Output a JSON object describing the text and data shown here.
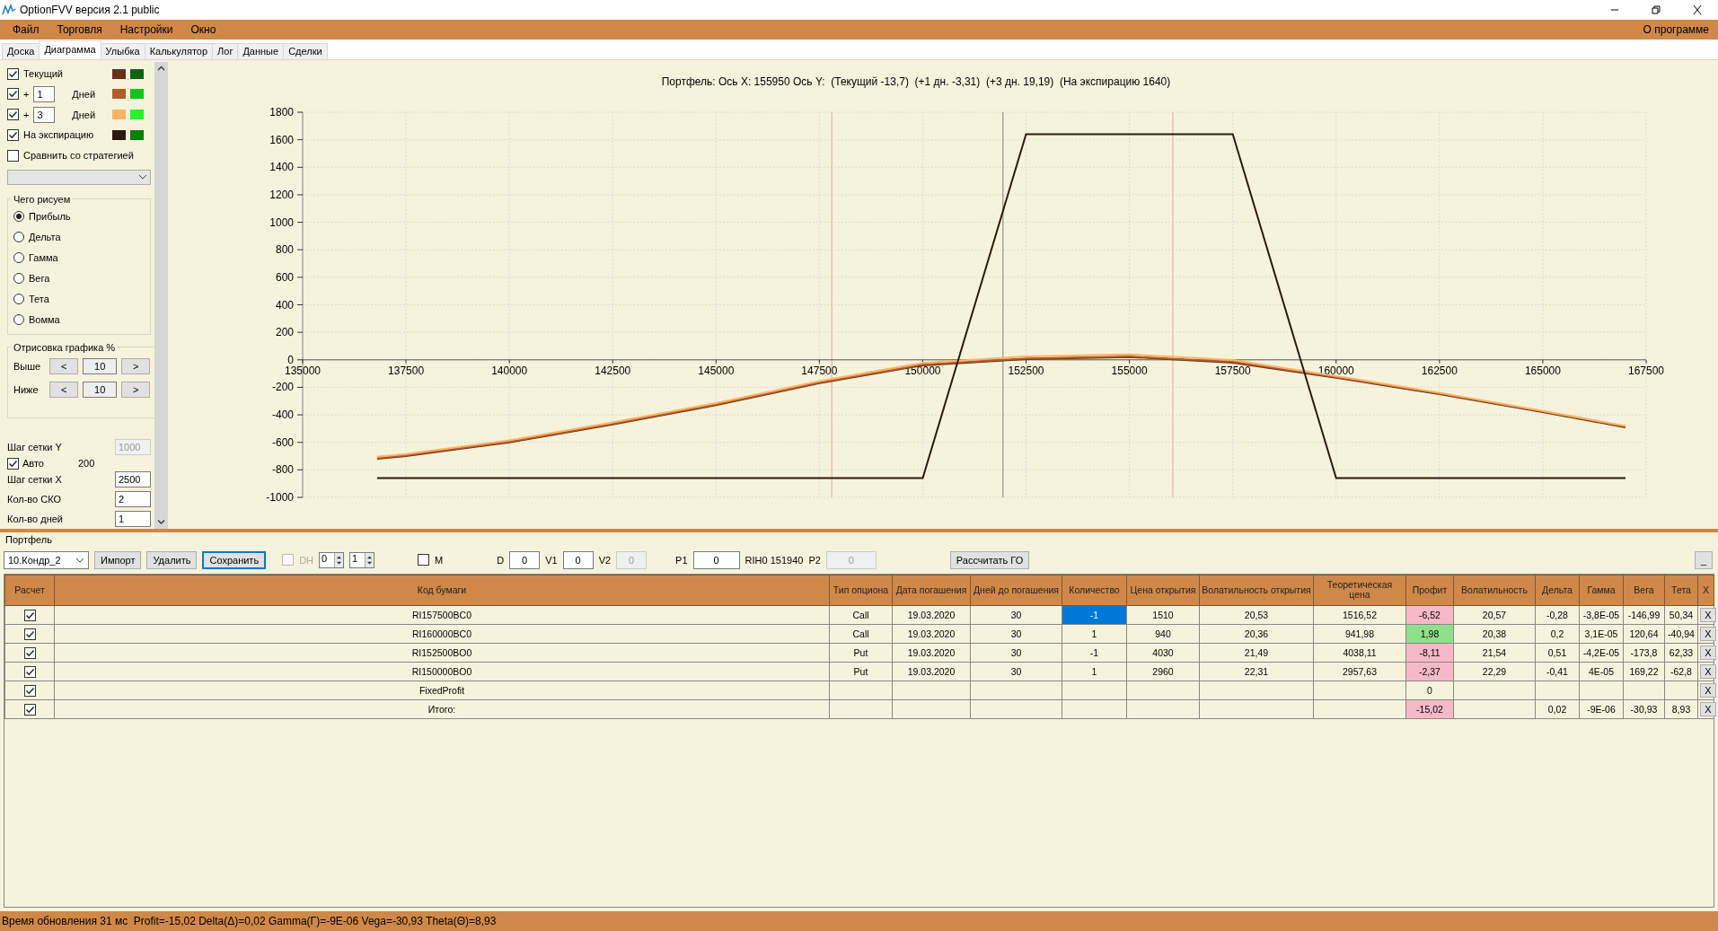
{
  "window": {
    "title": "OptionFVV версия 2.1 public"
  },
  "menu": {
    "items": [
      "Файл",
      "Торговля",
      "Настройки",
      "Окно"
    ],
    "right": "О программе"
  },
  "tabs": [
    {
      "label": "Доска",
      "selected": false
    },
    {
      "label": "Диаграмма",
      "selected": true
    },
    {
      "label": "Улыбка",
      "selected": false
    },
    {
      "label": "Калькулятор",
      "selected": false
    },
    {
      "label": "Лог",
      "selected": false
    },
    {
      "label": "Данные",
      "selected": false
    },
    {
      "label": "Сделки",
      "selected": false
    }
  ],
  "left_panel": {
    "series": [
      {
        "label": "Текущий",
        "checked": true,
        "swatches": [
          {
            "color": "#66301a"
          },
          {
            "color": "#0b6414"
          }
        ]
      },
      {
        "prefix": "+",
        "days": "1",
        "label": "Дней",
        "checked": true,
        "swatches": [
          {
            "color": "#b25c28"
          },
          {
            "color": "#13c41c"
          }
        ]
      },
      {
        "prefix": "+",
        "days": "3",
        "label": "Дней",
        "checked": true,
        "swatches": [
          {
            "color": "#ffb266"
          },
          {
            "color": "#2cf02c"
          }
        ]
      },
      {
        "label": "На экспирацию",
        "checked": true,
        "swatches": [
          {
            "color": "#2e1a0c"
          },
          {
            "color": "#068006"
          }
        ]
      }
    ],
    "compare": {
      "label": "Сравнить со стратегией",
      "checked": false
    },
    "draw_group": {
      "title": "Чего рисуем",
      "options": [
        {
          "label": "Прибыль",
          "selected": true
        },
        {
          "label": "Дельта",
          "selected": false
        },
        {
          "label": "Гамма",
          "selected": false
        },
        {
          "label": "Вега",
          "selected": false
        },
        {
          "label": "Тета",
          "selected": false
        },
        {
          "label": "Вомма",
          "selected": false
        }
      ]
    },
    "range_group": {
      "title": "Отрисовка графика %",
      "rows": [
        {
          "label": "Выше",
          "dec": "<",
          "value": "10",
          "inc": ">"
        },
        {
          "label": "Ниже",
          "dec": "<",
          "value": "10",
          "inc": ">"
        }
      ]
    },
    "settings": [
      {
        "kind": "field",
        "label": "Шаг сетки Y",
        "value": "1000",
        "disabled": true
      },
      {
        "kind": "checkbox",
        "label": "Авто",
        "checked": true,
        "note": "200"
      },
      {
        "kind": "field",
        "label": "Шаг сетки X",
        "value": "2500",
        "disabled": false
      },
      {
        "kind": "field",
        "label": "Кол-во СКО",
        "value": "2",
        "disabled": false
      },
      {
        "kind": "field",
        "label": "Кол-во дней",
        "value": "1",
        "disabled": false
      }
    ]
  },
  "chart": {
    "title": "Портфель: Ось X: 155950 Ось Y:  (Текущий -13,7)  (+1 дн. -3,31)  (+3 дн. 19,19)  (На экспирацию 1640)",
    "chart_data": {
      "type": "line",
      "x": [
        136800,
        137500,
        140000,
        142500,
        145000,
        147500,
        150000,
        152500,
        155000,
        157500,
        160000,
        162500,
        165000,
        167000
      ],
      "series": [
        {
          "color": "#66301a",
          "values": [
            -720,
            -700,
            -600,
            -470,
            -330,
            -170,
            -40,
            5,
            20,
            -20,
            -130,
            -250,
            -380,
            -490
          ]
        },
        {
          "color": "#b25c28",
          "values": [
            -715,
            -695,
            -595,
            -465,
            -325,
            -165,
            -35,
            10,
            25,
            -15,
            -125,
            -245,
            -375,
            -485
          ]
        },
        {
          "color": "#ffb266",
          "values": [
            -705,
            -685,
            -585,
            -455,
            -315,
            -155,
            -22,
            25,
            40,
            -2,
            -118,
            -240,
            -372,
            -482
          ]
        },
        {
          "color": "#2e1a0c",
          "values": [
            -860,
            -860,
            -860,
            -860,
            -860,
            -860,
            -860,
            1640,
            1640,
            1640,
            -860,
            -860,
            -860,
            -860
          ]
        }
      ],
      "xlim": [
        135000,
        167500
      ],
      "ylim": [
        -1000,
        1800
      ],
      "xticks": [
        135000,
        137500,
        140000,
        142500,
        145000,
        147500,
        150000,
        152500,
        155000,
        157500,
        160000,
        162500,
        165000,
        167500
      ],
      "yticks": [
        -1000,
        -800,
        -600,
        -400,
        -200,
        0,
        200,
        400,
        600,
        800,
        1000,
        1200,
        1400,
        1600,
        1800
      ],
      "grid": true,
      "ref_lines": [
        {
          "axis": "x",
          "value": 151940,
          "color": "#9a9a90"
        },
        {
          "axis": "x",
          "value": 147800,
          "color": "#e8b8b0"
        },
        {
          "axis": "x",
          "value": 156050,
          "color": "#e8b8b0"
        }
      ]
    }
  },
  "portfolio": {
    "title": "Портфель",
    "strategy": "10.Кондр_2",
    "buttons": [
      {
        "label": "Импорт",
        "focused": false
      },
      {
        "label": "Удалить",
        "focused": false
      },
      {
        "label": "Сохранить",
        "focused": true
      }
    ],
    "dh": {
      "label": "DH",
      "checked": false,
      "disabled": true
    },
    "spinners": [
      "0",
      "1"
    ],
    "m": {
      "label": "M",
      "checked": false
    },
    "params": [
      {
        "kind": "field",
        "label": "D",
        "value": "0",
        "disabled": false
      },
      {
        "kind": "field",
        "label": "V1",
        "value": "0",
        "disabled": false
      },
      {
        "kind": "field",
        "label": "V2",
        "value": "0",
        "disabled": true
      },
      {
        "kind": "field",
        "label": "P1",
        "value": "0",
        "disabled": false
      },
      {
        "kind": "text",
        "text": "RIH0 151940"
      },
      {
        "kind": "field",
        "label": "P2",
        "value": "0",
        "disabled": true
      }
    ],
    "calc_button": "Рассчитать ГО",
    "collapse_button": "_",
    "table": {
      "columns": [
        "Расчет",
        "Код бумаги",
        "Тип опциона",
        "Дата погашения",
        "Дней до погашения",
        "Количество",
        "Цена открытия",
        "Волатильность открытия",
        "Теоретическая цена",
        "Профит",
        "Волатильность",
        "Дельта",
        "Гамма",
        "Вега",
        "Тета",
        "X"
      ],
      "rows": [
        {
          "checked": true,
          "code": "RI157500BC0",
          "type": "Call",
          "expiry": "19.03.2020",
          "days": "30",
          "quantity": "-1",
          "selected": true,
          "open_price": "1510",
          "open_vol": "20,53",
          "theo_price": "1516,52",
          "profit": "-6,52",
          "color": "#f7b8c8",
          "vol": "20,57",
          "delta": "-0,28",
          "gamma": "-3,8E-05",
          "vega": "-146,99",
          "theta": "50,34",
          "remove": "X"
        },
        {
          "checked": true,
          "code": "RI160000BC0",
          "type": "Call",
          "expiry": "19.03.2020",
          "days": "30",
          "quantity": "1",
          "selected": false,
          "open_price": "940",
          "open_vol": "20,36",
          "theo_price": "941,98",
          "profit": "1,98",
          "color": "#8ee08a",
          "vol": "20,38",
          "delta": "0,2",
          "gamma": "3,1E-05",
          "vega": "120,64",
          "theta": "-40,94",
          "remove": "X"
        },
        {
          "checked": true,
          "code": "RI152500BO0",
          "type": "Put",
          "expiry": "19.03.2020",
          "days": "30",
          "quantity": "-1",
          "selected": false,
          "open_price": "4030",
          "open_vol": "21,49",
          "theo_price": "4038,11",
          "profit": "-8,11",
          "color": "#f7b8c8",
          "vol": "21,54",
          "delta": "0,51",
          "gamma": "-4,2E-05",
          "vega": "-173,8",
          "theta": "62,33",
          "remove": "X"
        },
        {
          "checked": true,
          "code": "RI150000BO0",
          "type": "Put",
          "expiry": "19.03.2020",
          "days": "30",
          "quantity": "1",
          "selected": false,
          "open_price": "2960",
          "open_vol": "22,31",
          "theo_price": "2957,63",
          "profit": "-2,37",
          "color": "#f7b8c8",
          "vol": "22,29",
          "delta": "-0,41",
          "gamma": "4E-05",
          "vega": "169,22",
          "theta": "-62,8",
          "remove": "X"
        },
        {
          "checked": true,
          "code": "FixedProfit",
          "selected": false,
          "profit": "0",
          "remove": "X"
        },
        {
          "checked": true,
          "code": "Итого:",
          "selected": false,
          "profit": "-15,02",
          "color": "#f7b8c8",
          "delta": "0,02",
          "gamma": "-9E-06",
          "vega": "-30,93",
          "theta": "8,93",
          "remove": "X"
        }
      ]
    }
  },
  "status_bar": "Время обновления 31 мс  Profit=-15,02 Delta(Δ)=0,02 Gamma(Γ)=-9E-06 Vega=-30,93 Theta(Θ)=8,93"
}
